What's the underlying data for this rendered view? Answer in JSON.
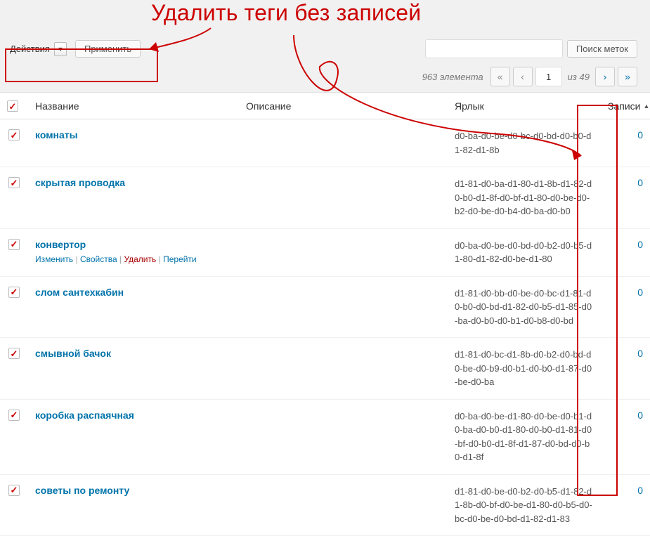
{
  "annotation": {
    "title": "Удалить теги без записей"
  },
  "toolbar": {
    "bulk_label": "Действия",
    "apply_label": "Применить",
    "search_button": "Поиск меток"
  },
  "tablenav": {
    "item_count": "963 элемента",
    "page_current": "1",
    "page_of": "из 49"
  },
  "columns": {
    "name": "Название",
    "description": "Описание",
    "slug": "Ярлык",
    "posts": "Записи"
  },
  "row_actions": {
    "edit": "Изменить",
    "quick_edit": "Свойства",
    "delete": "Удалить",
    "view": "Перейти"
  },
  "rows": [
    {
      "checked": true,
      "name": "комнаты",
      "slug": "d0-ba-d0-be-d0-bc-d0-bd-d0-b0-d1-82-d1-8b",
      "posts": "0",
      "show_actions": false
    },
    {
      "checked": true,
      "name": "скрытая проводка",
      "slug": "d1-81-d0-ba-d1-80-d1-8b-d1-82-d0-b0-d1-8f-d0-bf-d1-80-d0-be-d0-b2-d0-be-d0-b4-d0-ba-d0-b0",
      "posts": "0",
      "show_actions": false
    },
    {
      "checked": true,
      "name": "конвертор",
      "slug": "d0-ba-d0-be-d0-bd-d0-b2-d0-b5-d1-80-d1-82-d0-be-d1-80",
      "posts": "0",
      "show_actions": true
    },
    {
      "checked": true,
      "name": "слом сантехкабин",
      "slug": "d1-81-d0-bb-d0-be-d0-bc-d1-81-d0-b0-d0-bd-d1-82-d0-b5-d1-85-d0-ba-d0-b0-d0-b1-d0-b8-d0-bd",
      "posts": "0",
      "show_actions": false
    },
    {
      "checked": true,
      "name": "смывной бачок",
      "slug": "d1-81-d0-bc-d1-8b-d0-b2-d0-bd-d0-be-d0-b9-d0-b1-d0-b0-d1-87-d0-be-d0-ba",
      "posts": "0",
      "show_actions": false
    },
    {
      "checked": true,
      "name": "коробка распаячная",
      "slug": "d0-ba-d0-be-d1-80-d0-be-d0-b1-d0-ba-d0-b0-d1-80-d0-b0-d1-81-d0-bf-d0-b0-d1-8f-d1-87-d0-bd-d0-b0-d1-8f",
      "posts": "0",
      "show_actions": false
    },
    {
      "checked": true,
      "name": "советы по ремонту",
      "slug": "d1-81-d0-be-d0-b2-d0-b5-d1-82-d1-8b-d0-bf-d0-be-d1-80-d0-b5-d0-bc-d0-be-d0-bd-d1-82-d1-83",
      "posts": "0",
      "show_actions": false
    }
  ]
}
